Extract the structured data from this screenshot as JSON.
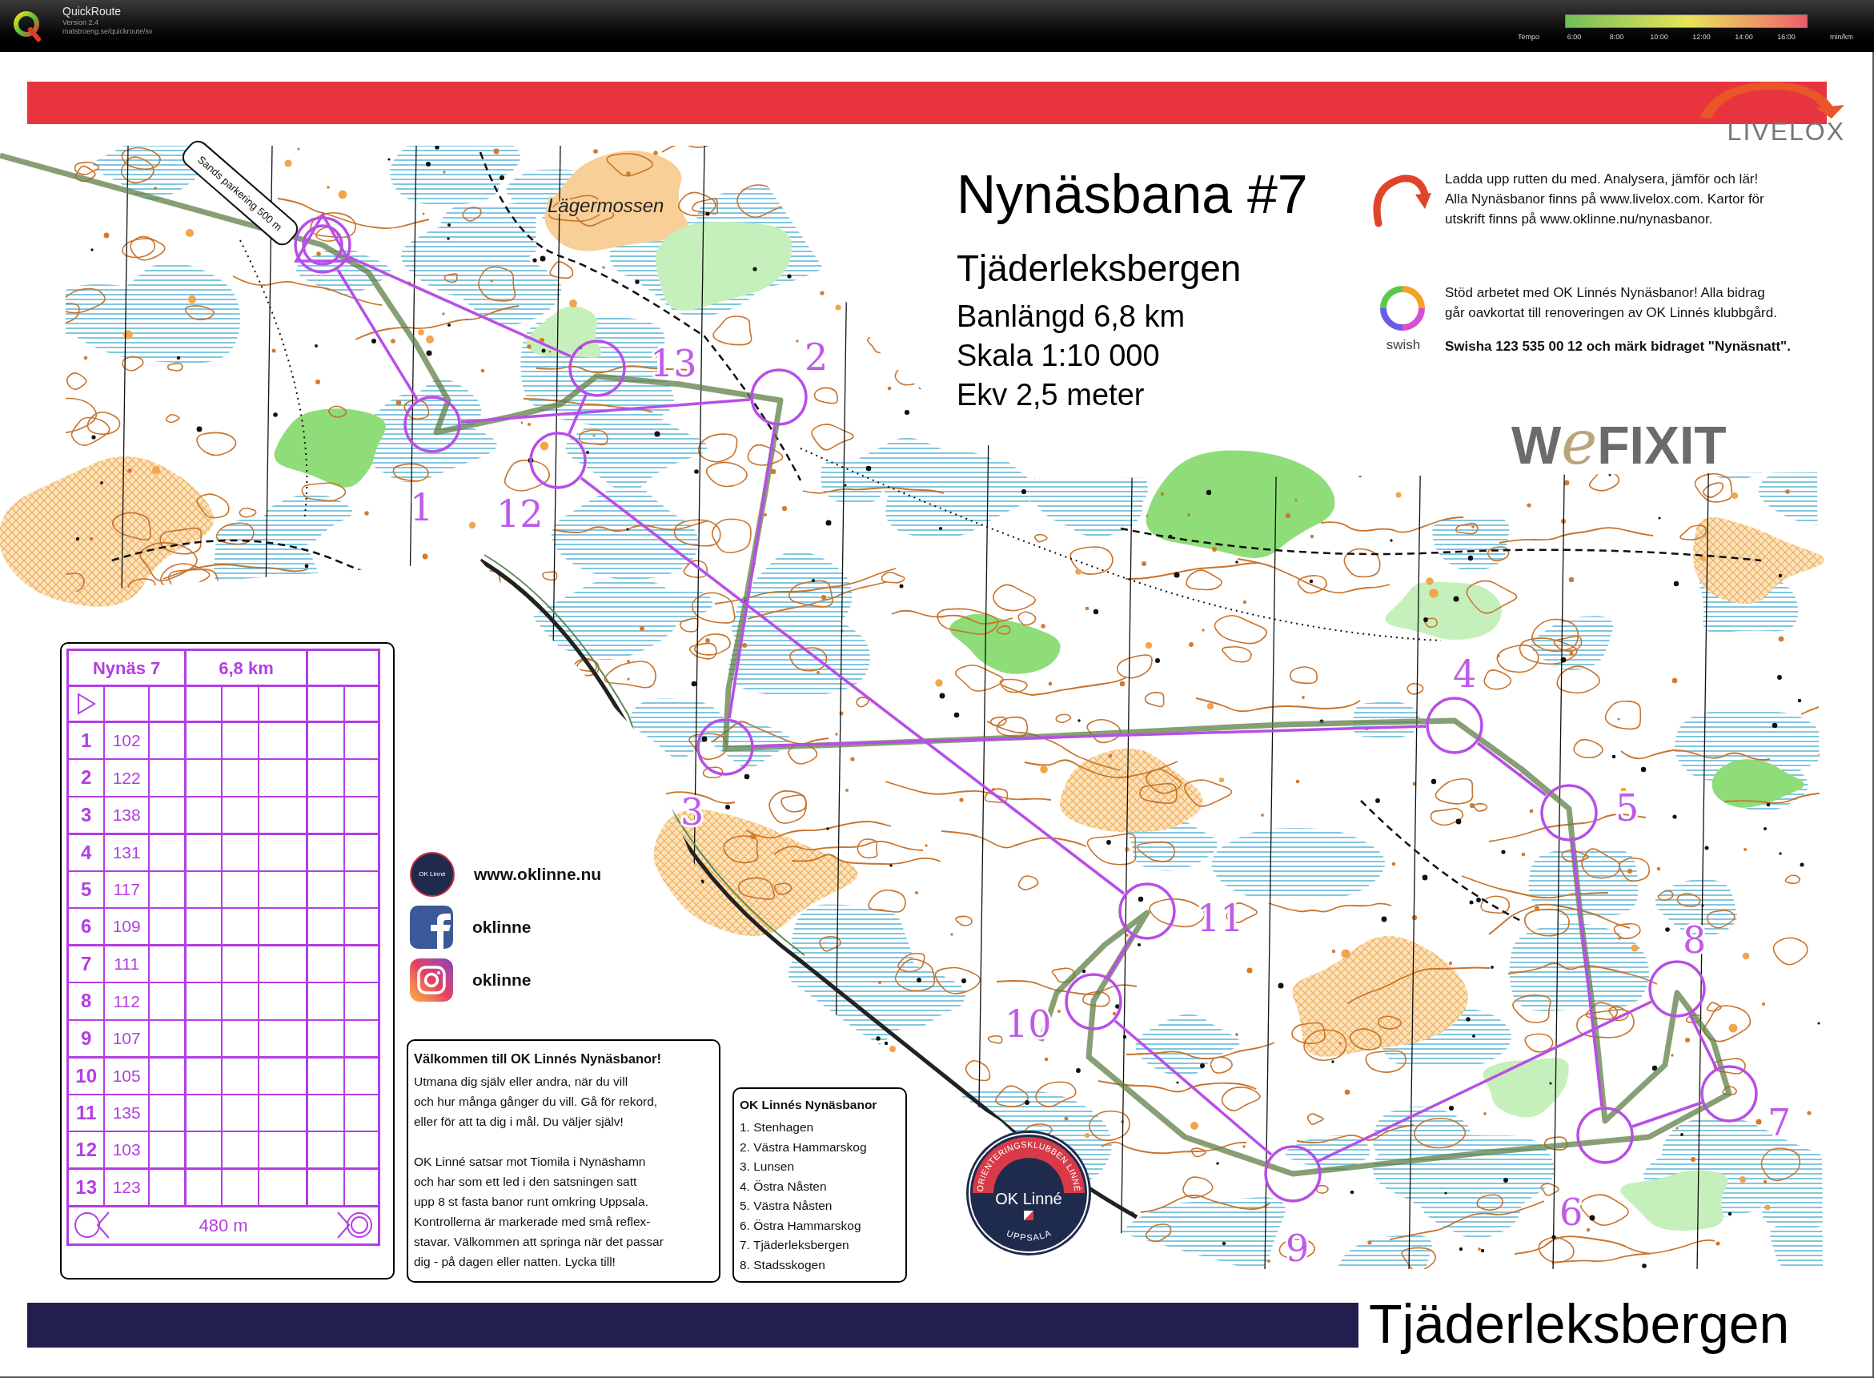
{
  "app": {
    "title": "QuickRoute",
    "version": "Version 2.4",
    "url": "matstroeng.se/quickroute/sv"
  },
  "tempo_legend": {
    "label": "Tempo",
    "ticks": [
      "6:00",
      "8:00",
      "10:00",
      "12:00",
      "14:00",
      "16:00"
    ],
    "unit": "min/km"
  },
  "map": {
    "title": "Nynäsbana #7",
    "area": "Tjäderleksbergen",
    "details": [
      "Banlängd 6,8 km",
      "Skala 1:10 000",
      "Ekv 2,5 meter"
    ],
    "place_label": "Lägermossen",
    "sign": "Sands parkering 500 m",
    "control_numbers": [
      "1",
      "2",
      "3",
      "4",
      "5",
      "6",
      "7",
      "8",
      "9",
      "10",
      "11",
      "12",
      "13"
    ]
  },
  "livelox": {
    "logo": "LIVELOX",
    "lines": [
      "Ladda upp rutten du med. Analysera, jämför och lär!",
      "Alla Nynäsbanor finns på www.livelox.com. Kartor för",
      "utskrift finns på www.oklinne.nu/nynasbanor."
    ]
  },
  "swish": {
    "logo": "swish",
    "lines": [
      "Stöd arbetet med OK Linnés Nynäsbanor! Alla bidrag",
      "går oavkortat till renoveringen av OK Linnés klubbgård."
    ],
    "call": "Swisha 123 535 00 12 och märk bidraget \"Nynäsnatt\"."
  },
  "sponsor_logo": [
    "W",
    "e",
    "FIXIT"
  ],
  "control_card": {
    "course": "Nynäs 7",
    "length": "6,8 km",
    "controls": [
      {
        "number": "1",
        "code": "102"
      },
      {
        "number": "2",
        "code": "122"
      },
      {
        "number": "3",
        "code": "138"
      },
      {
        "number": "4",
        "code": "131"
      },
      {
        "number": "5",
        "code": "117"
      },
      {
        "number": "6",
        "code": "109"
      },
      {
        "number": "7",
        "code": "111"
      },
      {
        "number": "8",
        "code": "112"
      },
      {
        "number": "9",
        "code": "107"
      },
      {
        "number": "10",
        "code": "105"
      },
      {
        "number": "11",
        "code": "135"
      },
      {
        "number": "12",
        "code": "103"
      },
      {
        "number": "13",
        "code": "123"
      }
    ],
    "finish_distance": "480 m"
  },
  "social": [
    {
      "kind": "web",
      "text": "www.oklinne.nu",
      "logo_text": "OK Linné"
    },
    {
      "kind": "facebook",
      "text": "oklinne"
    },
    {
      "kind": "instagram",
      "text": "oklinne"
    }
  ],
  "welcome": {
    "title": "Välkommen till OK Linnés Nynäsbanor!",
    "paragraphs": [
      [
        "Utmana dig själv eller andra, när du vill",
        "och hur många gånger du vill. Gå för rekord,",
        "eller för att ta dig i mål. Du väljer själv!"
      ],
      [
        "OK Linné satsar mot Tiomila i Nynäshamn",
        "och har som ett led i den satsningen satt",
        "upp 8 st fasta banor runt omkring Uppsala.",
        "Kontrollerna är markerade med små reflex-",
        "stavar. Välkommen att springa när det passar",
        "dig - på dagen eller natten. Lycka till!"
      ]
    ]
  },
  "course_list": {
    "title": "OK Linnés Nynäsbanor",
    "items": [
      "1. Stenhagen",
      "2. Västra Hammarskog",
      "3. Lunsen",
      "4. Östra Nåsten",
      "5. Västra Nåsten",
      "6. Östra Hammarskog",
      "7. Tjäderleksbergen",
      "8. Stadsskogen"
    ]
  },
  "club_badge": {
    "ring_text": "ORIENTERINGSKLUBBEN LINNÉ",
    "name": "OK Linné",
    "city": "UPPSALA"
  },
  "footer_title": "Tjäderleksbergen"
}
